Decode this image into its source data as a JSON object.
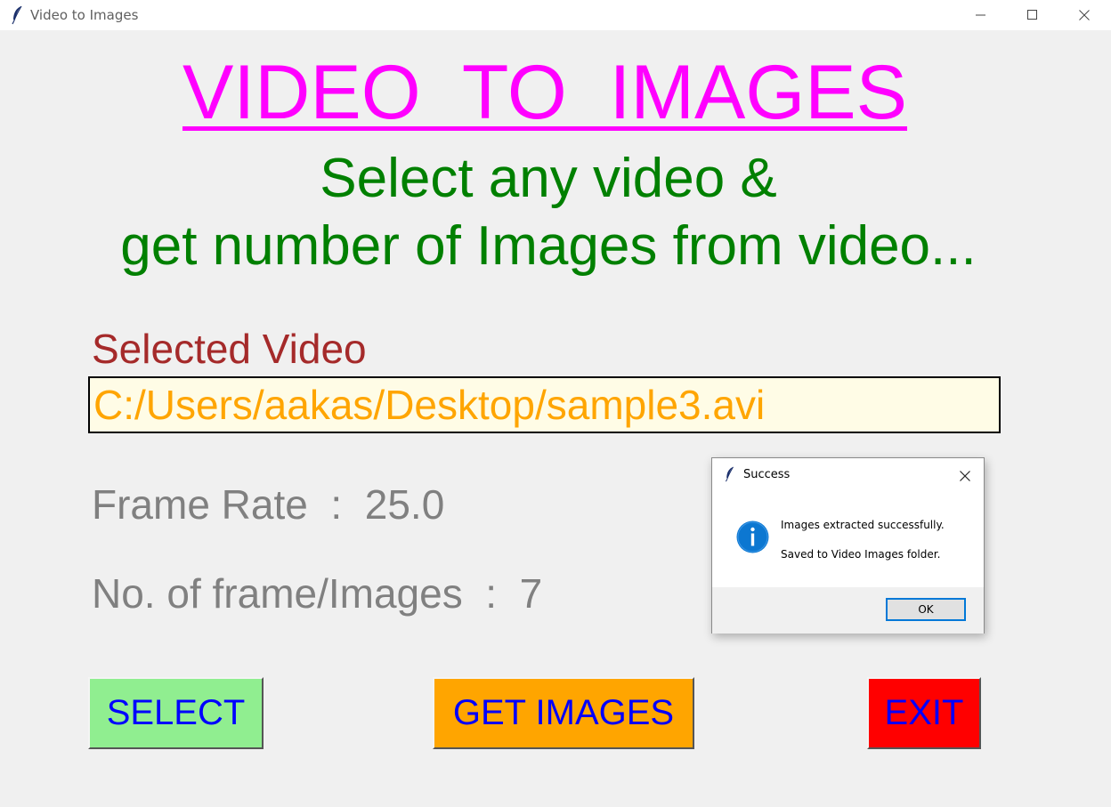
{
  "window": {
    "title": "Video to Images",
    "controls": {
      "minimize": "minimize-icon",
      "maximize": "maximize-icon",
      "close": "close-icon"
    }
  },
  "main": {
    "heading": "VIDEO  TO  IMAGES",
    "subtitle_line1": "Select any video &",
    "subtitle_line2": "get number of Images from video...",
    "selected_label": "Selected Video",
    "selected_path": "C:/Users/aakas/Desktop/sample3.avi",
    "frame_rate_text": "Frame Rate  :  25.0",
    "frame_count_text": "No. of frame/Images  :  7"
  },
  "buttons": {
    "select": "SELECT",
    "get_images": "GET IMAGES",
    "exit": "EXIT"
  },
  "dialog": {
    "title": "Success",
    "message_line1": "Images extracted successfully.",
    "message_line2": "Saved to Video Images folder.",
    "ok_label": "OK",
    "icon": "info-icon"
  },
  "colors": {
    "heading": "#ff00ff",
    "subtitle": "#008000",
    "selected_label": "#a52a2a",
    "path_text": "#ffa500",
    "path_background": "#fffce6",
    "info_text": "#808080",
    "button_text": "#0000ff",
    "select_button": "#90ee90",
    "get_images_button": "#ffa500",
    "exit_button": "#ff0000",
    "dialog_accent": "#0078d7"
  }
}
